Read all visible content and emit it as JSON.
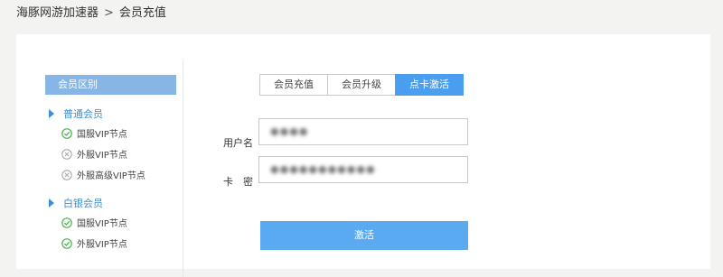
{
  "breadcrumb": {
    "root": "海豚网游加速器",
    "separator": ">",
    "current": "会员充值"
  },
  "sidebar": {
    "title": "会员区别",
    "groups": [
      {
        "label": "普通会员",
        "items": [
          {
            "label": "国服VIP节点",
            "status": "check"
          },
          {
            "label": "外服VIP节点",
            "status": "cross"
          },
          {
            "label": "外服高级VIP节点",
            "status": "cross"
          }
        ]
      },
      {
        "label": "白银会员",
        "items": [
          {
            "label": "国服VIP节点",
            "status": "check"
          },
          {
            "label": "外服VIP节点",
            "status": "check"
          }
        ]
      }
    ]
  },
  "tabs": [
    {
      "label": "会员充值",
      "active": false
    },
    {
      "label": "会员升级",
      "active": false
    },
    {
      "label": "点卡激活",
      "active": true
    }
  ],
  "form": {
    "username_label": "用户名",
    "username_value": "●●●●",
    "password_label": "卡　密",
    "password_value": "●●●●●●●●●●●",
    "submit_label": "激活"
  },
  "colors": {
    "accent": "#4a9eef",
    "sidebar_title_bg": "#87b5e5",
    "check": "#4cb04c",
    "cross": "#aaaaaa"
  }
}
